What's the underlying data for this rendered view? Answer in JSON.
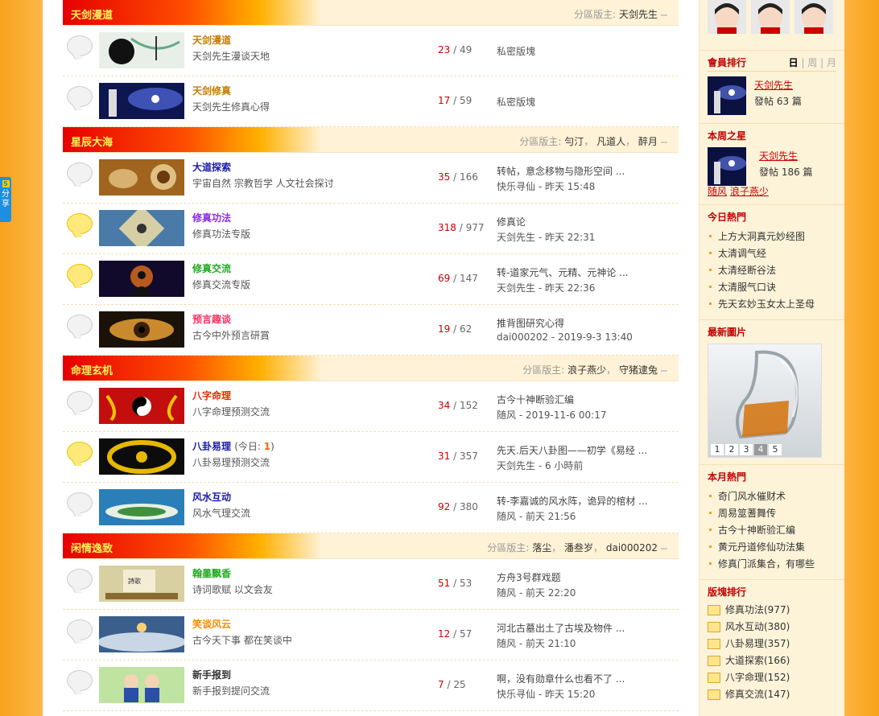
{
  "share_label": "分享",
  "mods_label": "分區版主:",
  "categories": [
    {
      "title": "天剑漫道",
      "mods": [
        "天剑先生"
      ],
      "forums": [
        {
          "name": "天剑漫道",
          "name_color": "#c77b00",
          "desc": "天剑先生漫谈天地",
          "threads": "23",
          "posts": "49",
          "last_title": "私密版塊",
          "last_meta": "",
          "new": false,
          "thumb": "dao"
        },
        {
          "name": "天剑修真",
          "name_color": "#c77b00",
          "desc": "天剑先生修真心得",
          "threads": "17",
          "posts": "59",
          "last_title": "私密版塊",
          "last_meta": "",
          "new": false,
          "thumb": "xiuzhen"
        }
      ]
    },
    {
      "title": "星辰大海",
      "mods": [
        "勻汀",
        "凡道人",
        "醉月"
      ],
      "forums": [
        {
          "name": "大道探索",
          "name_color": "#1a1aaa",
          "desc": "宇宙自然 宗教哲学 人文社会探讨",
          "threads": "35",
          "posts": "166",
          "last_title": "转帖，意念移物与隐形空间 ...",
          "last_meta": "快乐寻仙 - 昨天 15:48",
          "new": false,
          "thumb": "explore"
        },
        {
          "name": "修真功法",
          "name_color": "#8a2be2",
          "desc": "修真功法专版",
          "threads": "318",
          "posts": "977",
          "last_title": "修真论",
          "last_meta": "天剑先生 - 昨天 22:31",
          "new": true,
          "thumb": "gongfa"
        },
        {
          "name": "修真交流",
          "name_color": "#22aa22",
          "desc": "修真交流专版",
          "threads": "69",
          "posts": "147",
          "last_title": "转-道家元气、元精、元神论 ...",
          "last_meta": "天剑先生 - 昨天 22:36",
          "new": true,
          "thumb": "meditate"
        },
        {
          "name": "预言趣谈",
          "name_color": "#ff3366",
          "desc": "古今中外预言研賞",
          "threads": "19",
          "posts": "62",
          "last_title": "推背图研究心得",
          "last_meta": "dai000202 - 2019-9-3 13:40",
          "new": false,
          "thumb": "eye"
        }
      ]
    },
    {
      "title": "命理玄机",
      "mods": [
        "浪子燕少",
        "守猪逮兔"
      ],
      "forums": [
        {
          "name": "八字命理",
          "name_color": "#e03000",
          "desc": "八字命理预测交流",
          "threads": "34",
          "posts": "152",
          "last_title": "古今十神断验汇编",
          "last_meta": "随风 - 2019-11-6 00:17",
          "new": false,
          "thumb": "bazi"
        },
        {
          "name": "八卦易理",
          "name_color": "#1a1aaa",
          "today_label": "(今日:",
          "today_count": "1",
          "today_close": ")",
          "desc": "八卦易理预测交流",
          "threads": "31",
          "posts": "357",
          "last_title": "先天.后天八卦图——初学《易经 ...",
          "last_meta": "天剑先生 - 6 小時前",
          "new": true,
          "thumb": "bagua"
        },
        {
          "name": "风水互动",
          "name_color": "#1a1aaa",
          "desc": "风水气理交流",
          "threads": "92",
          "posts": "380",
          "last_title": "转-李嘉诚的风水阵，诡异的棺材 ...",
          "last_meta": "随风 - 前天 21:56",
          "new": false,
          "thumb": "island"
        }
      ]
    },
    {
      "title": "闲情逸致",
      "mods": [
        "落尘",
        "潘叁岁",
        "dai000202"
      ],
      "forums": [
        {
          "name": "翰墨飘香",
          "name_color": "#22aa22",
          "desc": "诗词歌赋  以文会友",
          "threads": "51",
          "posts": "53",
          "last_title": "方舟3号群戏题",
          "last_meta": "随风 - 前天 22:20",
          "new": false,
          "thumb": "poem"
        },
        {
          "name": "笑谈风云",
          "name_color": "#ff8800",
          "desc": "古今天下事  都在笑谈中",
          "threads": "12",
          "posts": "57",
          "last_title": "河北古墓出土了古埃及物件 ...",
          "last_meta": "随风 - 前天 21:10",
          "new": false,
          "thumb": "clouds"
        },
        {
          "name": "新手报到",
          "name_color": "#333333",
          "desc": "新手报到提问交流",
          "threads": "7",
          "posts": "25",
          "last_title": "啊，没有勋章什么也看不了 ...",
          "last_meta": "快乐寻仙 - 昨天 15:20",
          "new": false,
          "thumb": "kids"
        }
      ]
    }
  ],
  "sidebar": {
    "member_rank": {
      "title": "會員排行",
      "tabs": [
        "日",
        "周",
        "月"
      ],
      "user": "天剑先生",
      "posts": "發帖 63 篇"
    },
    "week_star": {
      "title": "本周之星",
      "user": "天剑先生",
      "posts": "發帖 186 篇",
      "others": [
        "随风",
        "浪子燕少"
      ]
    },
    "hot_today": {
      "title": "今日熱門",
      "items": [
        "上方大洞真元妙经图",
        "太清调气经",
        "太清经断谷法",
        "太清服气口诀",
        "先天玄妙玉女太上圣母"
      ]
    },
    "new_pics": {
      "title": "最新圖片",
      "pages": [
        "1",
        "2",
        "3",
        "4",
        "5"
      ],
      "active": "4"
    },
    "hot_month": {
      "title": "本月熱門",
      "items": [
        "奇门风水催财术",
        "周易筮蓍舞传",
        "古今十神断验汇编",
        "黄元丹道修仙功法集",
        "修真门派集合，有哪些"
      ]
    },
    "board_rank": {
      "title": "版塊排行",
      "items": [
        "修真功法(977)",
        "风水互动(380)",
        "八卦易理(357)",
        "大道探索(166)",
        "八字命理(152)",
        "修真交流(147)"
      ]
    }
  }
}
